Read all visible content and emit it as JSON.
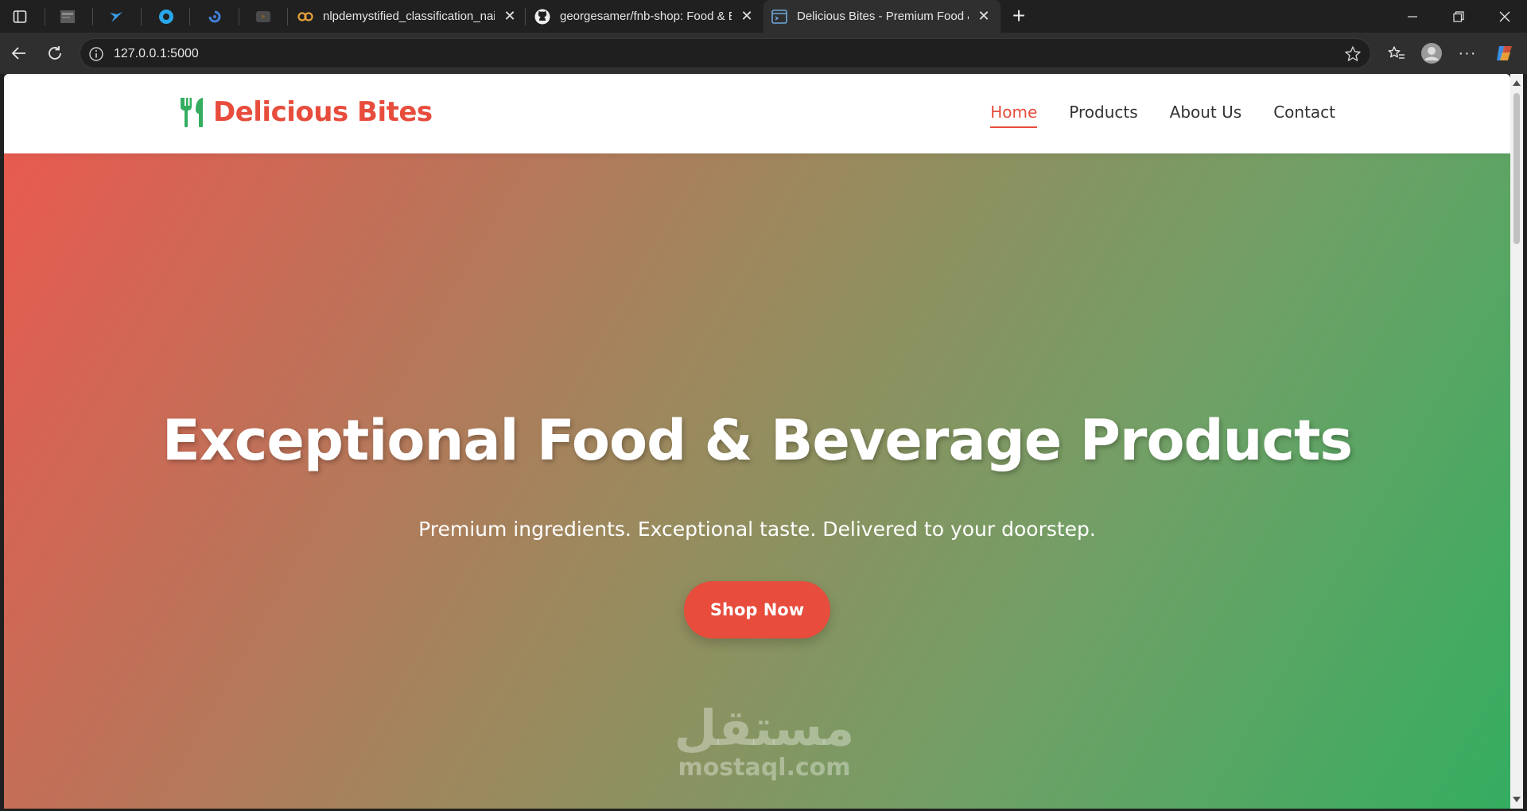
{
  "browser": {
    "tabs": [
      {
        "title": "nlpdemystified_classification_naiv",
        "favicon": "colab-icon"
      },
      {
        "title": "georgesamer/fnb-shop: Food & B",
        "favicon": "github-icon"
      },
      {
        "title": "Delicious Bites - Premium Food &",
        "favicon": "page-icon",
        "active": true
      }
    ],
    "url": "127.0.0.1:5000"
  },
  "site": {
    "brand": "Delicious Bites",
    "nav": [
      {
        "label": "Home",
        "active": true
      },
      {
        "label": "Products"
      },
      {
        "label": "About Us"
      },
      {
        "label": "Contact"
      }
    ]
  },
  "hero": {
    "title": "Exceptional Food & Beverage Products",
    "subtitle": "Premium ingredients. Exceptional taste. Delivered to your doorstep.",
    "cta": "Shop Now"
  },
  "watermark": {
    "arabic": "مستقل",
    "latin": "mostaql.com"
  },
  "colors": {
    "brand": "#e74c3c",
    "green": "#34ad60",
    "chrome_dark": "#202020"
  }
}
